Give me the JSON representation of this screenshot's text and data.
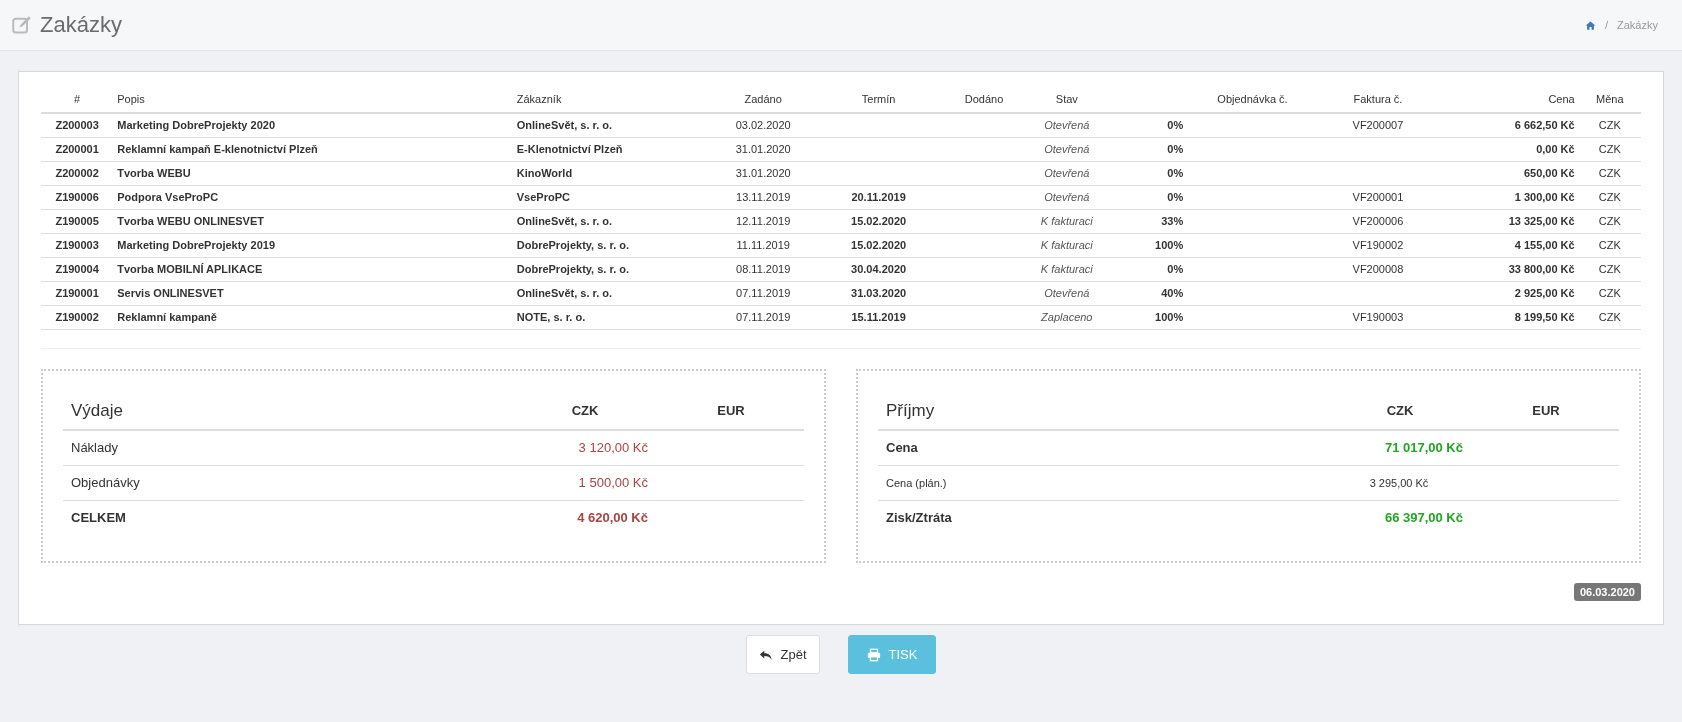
{
  "header": {
    "title": "Zakázky",
    "breadcrumb": [
      "/",
      "Zakázky"
    ]
  },
  "table": {
    "columns": [
      {
        "kind": "text",
        "label": "#"
      },
      {
        "kind": "text",
        "label": "Popis"
      },
      {
        "kind": "text",
        "label": "Zákazník"
      },
      {
        "kind": "text",
        "label": "Zadáno"
      },
      {
        "kind": "text",
        "label": "Termín"
      },
      {
        "kind": "text",
        "label": "Dodáno"
      },
      {
        "kind": "text",
        "label": "Stav"
      },
      {
        "kind": "blank"
      },
      {
        "kind": "text",
        "label": "Objednávka č."
      },
      {
        "kind": "text",
        "label": "Faktura č."
      },
      {
        "kind": "text",
        "label": "Cena"
      },
      {
        "kind": "text",
        "label": "Měna"
      }
    ],
    "rows": [
      {
        "number": "Z200003",
        "description": "Marketing DobreProjekty 2020",
        "customer": "OnlineSvět, s. r. o.",
        "ordered": "03.02.2020",
        "status": "Otevřená",
        "progress": "0%",
        "invoice": "VF200007",
        "price": "6 662,50 Kč",
        "currency": "CZK"
      },
      {
        "number": "Z200001",
        "description": "Reklamní kampaň E-klenotnictví Plzeň",
        "customer": "E-Klenotnictví Plzeň",
        "ordered": "31.01.2020",
        "status": "Otevřená",
        "progress": "0%",
        "price": "0,00 Kč",
        "currency": "CZK"
      },
      {
        "number": "Z200002",
        "description": "Tvorba WEBU",
        "customer": "KinoWorld",
        "ordered": "31.01.2020",
        "status": "Otevřená",
        "progress": "0%",
        "price": "650,00 Kč",
        "currency": "CZK"
      },
      {
        "number": "Z190006",
        "description": "Podpora VseProPC",
        "customer": "VseProPC",
        "ordered": "13.11.2019",
        "deadline": "20.11.2019",
        "status": "Otevřená",
        "progress": "0%",
        "invoice": "VF200001",
        "price": "1 300,00 Kč",
        "currency": "CZK"
      },
      {
        "number": "Z190005",
        "description": "Tvorba WEBU ONLINESVET",
        "customer": "OnlineSvět, s. r. o.",
        "ordered": "12.11.2019",
        "deadline": "15.02.2020",
        "status": "K fakturaci",
        "progress": "33%",
        "invoice": "VF200006",
        "price": "13 325,00 Kč",
        "currency": "CZK"
      },
      {
        "number": "Z190003",
        "description": "Marketing DobreProjekty 2019",
        "customer": "DobreProjekty, s. r. o.",
        "ordered": "11.11.2019",
        "deadline": "15.02.2020",
        "status": "K fakturaci",
        "progress": "100%",
        "invoice": "VF190002",
        "price": "4 155,00 Kč",
        "currency": "CZK"
      },
      {
        "number": "Z190004",
        "description": "Tvorba MOBILNÍ APLIKACE",
        "customer": "DobreProjekty, s. r. o.",
        "ordered": "08.11.2019",
        "deadline": "30.04.2020",
        "status": "K fakturaci",
        "progress": "0%",
        "invoice": "VF200008",
        "price": "33 800,00 Kč",
        "currency": "CZK"
      },
      {
        "number": "Z190001",
        "description": "Servis ONLINESVET",
        "customer": "OnlineSvět, s. r. o.",
        "ordered": "07.11.2019",
        "deadline": "31.03.2020",
        "status": "Otevřená",
        "progress": "40%",
        "price": "2 925,00 Kč",
        "currency": "CZK"
      },
      {
        "number": "Z190002",
        "description": "Reklamní kampaně",
        "customer": "NOTE, s. r. o.",
        "ordered": "07.11.2019",
        "deadline": "15.11.2019",
        "status": "Zaplaceno",
        "progress": "100%",
        "invoice": "VF190003",
        "price": "8 199,50 Kč",
        "currency": "CZK"
      }
    ]
  },
  "summaries": [
    {
      "title": "Výdaje",
      "columns": [
        "CZK",
        "EUR"
      ],
      "rows": [
        {
          "kind": "normal",
          "color": "#a94442",
          "label": "Náklady",
          "czk": "3 120,00 Kč"
        },
        {
          "kind": "normal",
          "color": "#a94442",
          "label": "Objednávky",
          "czk": "1 500,00 Kč"
        },
        {
          "kind": "total",
          "color": "#a94442",
          "label": "CELKEM",
          "czk": "4 620,00 Kč"
        }
      ]
    },
    {
      "title": "Příjmy",
      "columns": [
        "CZK",
        "EUR"
      ],
      "rows": [
        {
          "kind": "total",
          "color": "#22a622",
          "label": "Cena",
          "czk": "71 017,00 Kč"
        },
        {
          "kind": "sub",
          "label": "Cena (plán.)",
          "czk": "3 295,00 Kč"
        },
        {
          "kind": "total",
          "color": "#22a622",
          "label": "Zisk/Ztráta",
          "czk": "66 397,00 Kč"
        }
      ]
    }
  ],
  "date_badge": "06.03.2020",
  "buttons": [
    {
      "kind": "back",
      "label": "Zpět"
    },
    {
      "kind": "print",
      "label": "TISK"
    }
  ]
}
